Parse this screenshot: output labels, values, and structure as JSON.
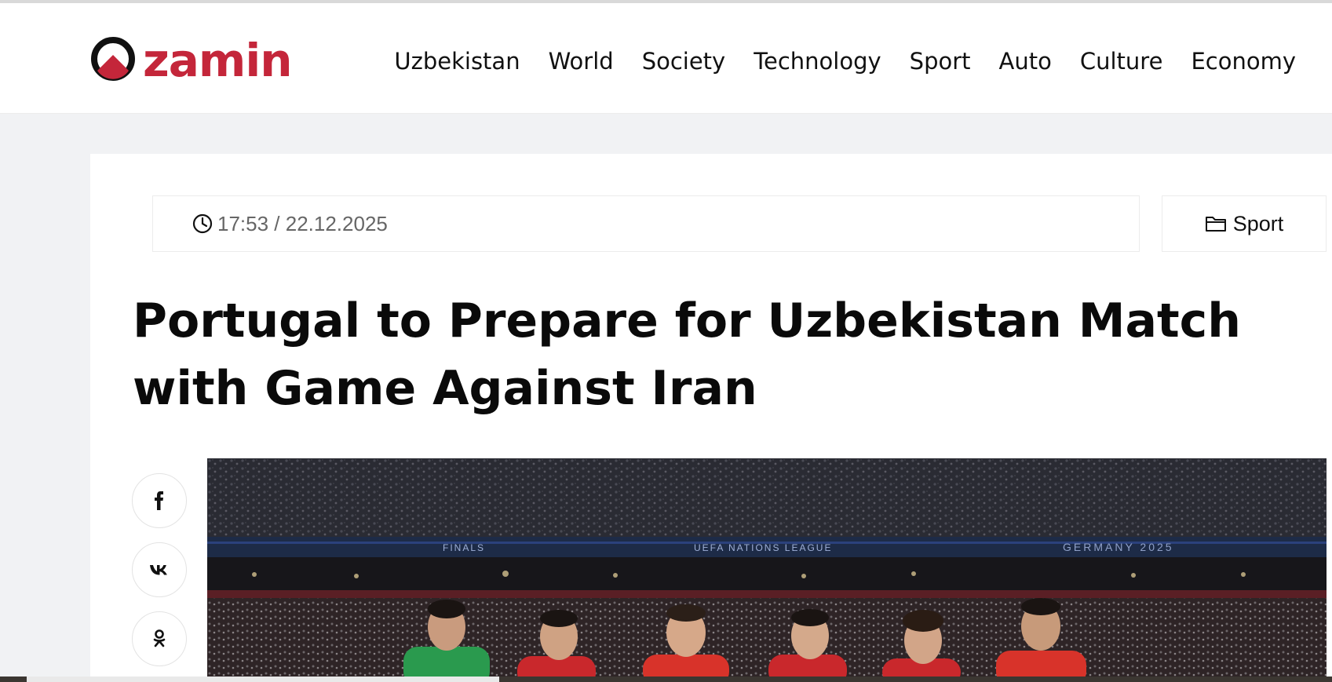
{
  "brand": {
    "name": "zamin",
    "color": "#c4263a"
  },
  "nav": {
    "items": [
      {
        "label": "Uzbekistan"
      },
      {
        "label": "World"
      },
      {
        "label": "Society"
      },
      {
        "label": "Technology"
      },
      {
        "label": "Sport"
      },
      {
        "label": "Auto"
      },
      {
        "label": "Culture"
      },
      {
        "label": "Economy"
      }
    ]
  },
  "article": {
    "datetime": "17:53 / 22.12.2025",
    "category": "Sport",
    "title": "Portugal to Prepare for Uzbekistan Match with Game Against Iran",
    "image_text": {
      "banner_left": "FINALS",
      "banner_mid": "UEFA NATIONS LEAGUE",
      "banner_right": "GERMANY 2025"
    }
  },
  "share": [
    {
      "icon": "facebook-icon"
    },
    {
      "icon": "vk-icon"
    },
    {
      "icon": "odnoklassniki-icon"
    }
  ],
  "icons": {
    "clock": "clock-icon",
    "folder": "folder-icon"
  }
}
